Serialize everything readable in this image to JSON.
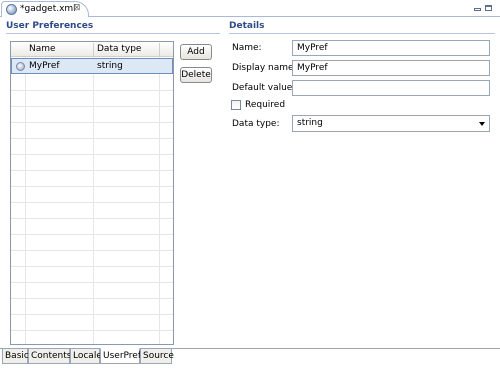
{
  "editor": {
    "tab_title": "*gadget.xml",
    "close_glyph": "⊠",
    "file_icon": "gadget-file-icon",
    "window_controls": [
      "minimize-icon",
      "maximize-icon"
    ]
  },
  "left": {
    "title": "User Preferences",
    "columns": [
      "Name",
      "Data type"
    ],
    "rows": [
      {
        "name": "MyPref",
        "type": "string",
        "selected": true
      }
    ],
    "buttons": {
      "add": "Add",
      "delete": "Delete"
    }
  },
  "details": {
    "title": "Details",
    "name_label": "Name:",
    "name_value": "MyPref",
    "display_label": "Display name:",
    "display_value": "MyPref",
    "default_label": "Default value:",
    "default_value": "",
    "required_label": "Required",
    "required_checked": false,
    "datatype_label": "Data type:",
    "datatype_value": "string"
  },
  "pages": {
    "tabs": [
      "Basic",
      "Contents",
      "Locale",
      "UserPref",
      "Source"
    ],
    "active": "UserPref"
  },
  "colors": {
    "section_title": "#2e4b85",
    "selection": "#dde8f7",
    "border": "#9aa6b9"
  }
}
